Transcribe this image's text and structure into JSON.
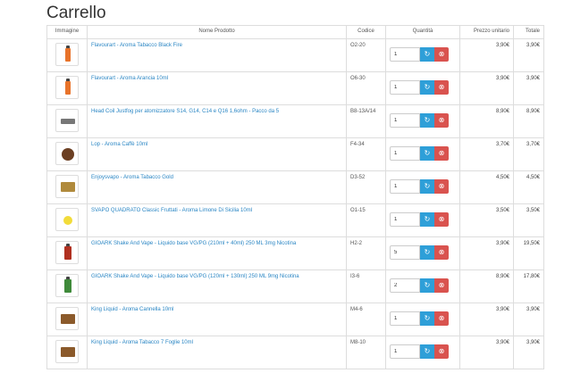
{
  "page": {
    "title": "Carrello"
  },
  "columns": {
    "image": "Immagine",
    "name": "Nome Prodotto",
    "code": "Codice",
    "qty": "Quantità",
    "unit": "Prezzo unitario",
    "total": "Totale"
  },
  "icons": {
    "update": "refresh-icon",
    "remove": "remove-icon"
  },
  "colors": {
    "link": "#2a86c4",
    "update": "#2e9fd8",
    "remove": "#d9534f"
  },
  "items": [
    {
      "name": "Flavourart - Aroma Tabacco Black Fire",
      "code": "O2-20",
      "qty": "1",
      "unit": "3,90€",
      "total": "3,90€",
      "thumb": "bottle-orange"
    },
    {
      "name": "Flavourart - Aroma Arancia 10ml",
      "code": "O6-30",
      "qty": "1",
      "unit": "3,90€",
      "total": "3,90€",
      "thumb": "bottle-orange"
    },
    {
      "name": "Head Coil Justfog per atomizzatore S14, G14, C14 e Q16 1,6ohm - Pacco da 5",
      "code": "B8-13A/14",
      "qty": "1",
      "unit": "8,90€",
      "total": "8,90€",
      "thumb": "coil"
    },
    {
      "name": "Lop - Aroma Caffè 10ml",
      "code": "F4-34",
      "qty": "1",
      "unit": "3,70€",
      "total": "3,70€",
      "thumb": "coffee"
    },
    {
      "name": "Enjoysvapo - Aroma Tabacco Gold",
      "code": "D3-52",
      "qty": "1",
      "unit": "4,50€",
      "total": "4,50€",
      "thumb": "box-gold"
    },
    {
      "name": "SVAPO QUADRATO Classic Fruttati - Aroma Limone Di Sicilia 10ml",
      "code": "O1-15",
      "qty": "1",
      "unit": "3,50€",
      "total": "3,50€",
      "thumb": "lemon"
    },
    {
      "name": "GIOARK Shake And Vape - Liquido base VG/PG (210ml + 40ml) 250 ML 3mg Nicotina",
      "code": "H2-2",
      "qty": "5",
      "unit": "3,90€",
      "total": "19,50€",
      "thumb": "bottle-red"
    },
    {
      "name": "GIOARK Shake And Vape - Liquido base VG/PG (120ml + 130ml) 250 ML 9mg Nicotina",
      "code": "I3-6",
      "qty": "2",
      "unit": "8,90€",
      "total": "17,80€",
      "thumb": "bottle-green"
    },
    {
      "name": "King Liquid - Aroma Cannella 10ml",
      "code": "M4-6",
      "qty": "1",
      "unit": "3,90€",
      "total": "3,90€",
      "thumb": "box-brown"
    },
    {
      "name": "King Liquid - Aroma Tabacco 7 Foglie 10ml",
      "code": "M8-10",
      "qty": "1",
      "unit": "3,90€",
      "total": "3,90€",
      "thumb": "box-brown"
    }
  ]
}
